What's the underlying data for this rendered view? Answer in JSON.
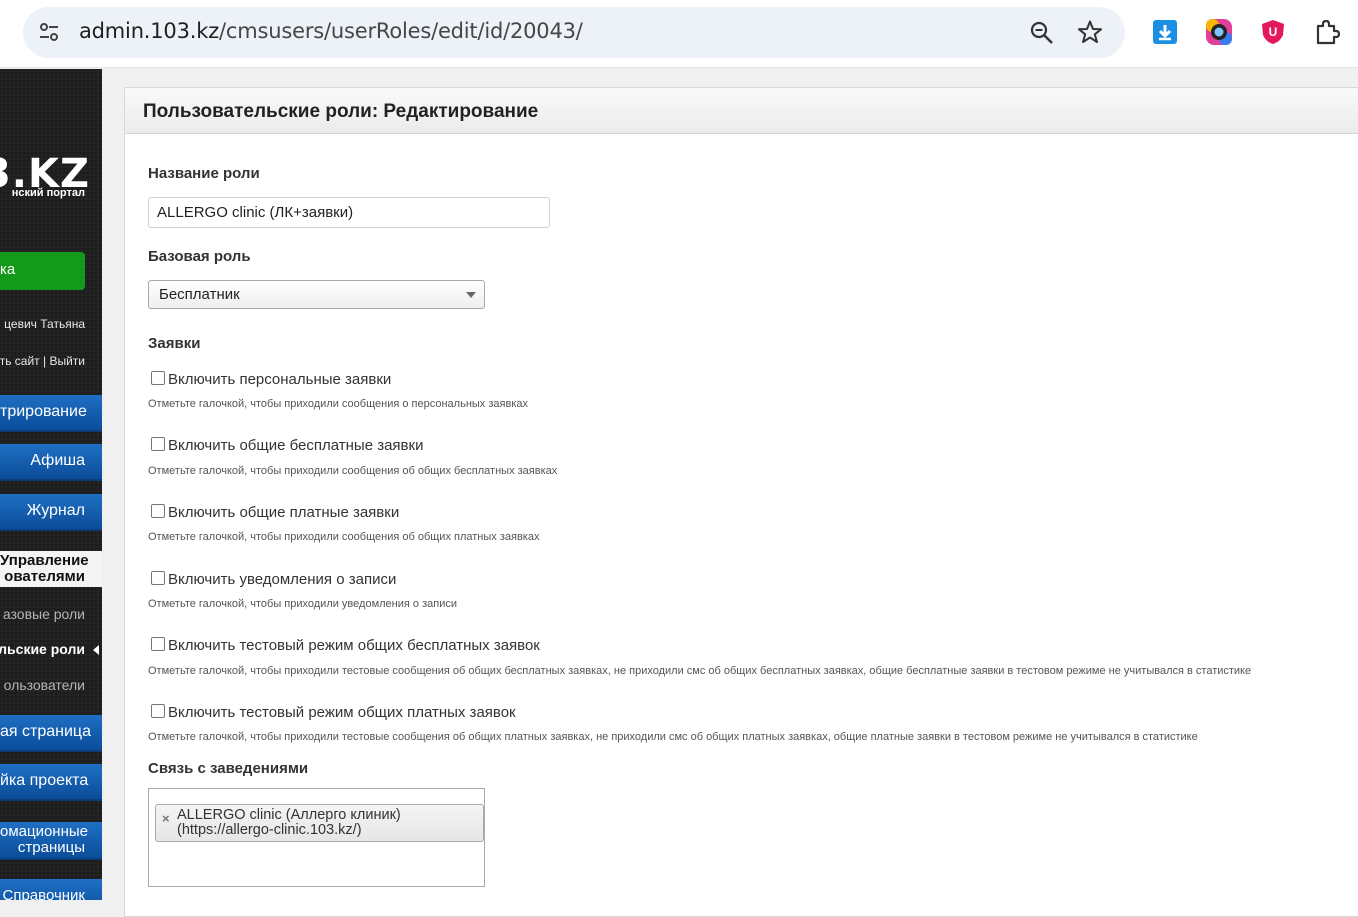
{
  "browser": {
    "url_host": "admin.103.kz",
    "url_path": "/cmsusers/userRoles/edit/id/20043/"
  },
  "sidebar": {
    "logo": "3.KZ",
    "logo_sub": "нский портал",
    "green_button": "ка",
    "user_name": "цевич Татьяна",
    "site_logout": "ть сайт | Выйти",
    "items": [
      {
        "label": "трирование"
      },
      {
        "label": "Афиша"
      },
      {
        "label": "Журнал"
      }
    ],
    "section_title_line1": "Управление",
    "section_title_line2": "ователями",
    "sub_items": [
      {
        "label": "азовые роли"
      },
      {
        "label": "льские роли"
      },
      {
        "label": "ользователи"
      }
    ],
    "items_bottom": [
      {
        "label": "ая страница"
      },
      {
        "label": "йка проекта"
      },
      {
        "label_line1": "омационные",
        "label_line2": "страницы"
      },
      {
        "label": "Справочник"
      }
    ]
  },
  "panel": {
    "title": "Пользовательские роли: Редактирование",
    "role_name_label": "Название роли",
    "role_name_value": "ALLERGO clinic (ЛК+заявки)",
    "base_role_label": "Базовая роль",
    "base_role_value": "Бесплатник",
    "requests_label": "Заявки",
    "checkboxes": [
      {
        "label": "Включить персональные заявки",
        "hint": "Отметьте галочкой, чтобы приходили сообщения о персональных заявках"
      },
      {
        "label": "Включить общие бесплатные заявки",
        "hint": "Отметьте галочкой, чтобы приходили сообщения об общих бесплатных заявках"
      },
      {
        "label": "Включить общие платные заявки",
        "hint": "Отметьте галочкой, чтобы приходили сообщения об общих платных заявках"
      },
      {
        "label": "Включить уведомления о записи",
        "hint": "Отметьте галочкой, чтобы приходили уведомления о записи"
      },
      {
        "label": "Включить тестовый режим общих бесплатных заявок",
        "hint": "Отметьте галочкой, чтобы приходили тестовые сообщения об общих бесплатных заявках, не приходили смс об общих бесплатных заявках, общие бесплатные заявки в тестовом режиме не учитывался в статистике"
      },
      {
        "label": "Включить тестовый режим общих платных заявок",
        "hint": "Отметьте галочкой, чтобы приходили тестовые сообщения об общих платных заявках, не приходили смс об общих платных заявках, общие платные заявки в тестовом режиме не учитывался в статистике"
      }
    ],
    "venues_label": "Связь с заведениями",
    "venue_chip_line1": "ALLERGO clinic (Аллерго клиник)",
    "venue_chip_line2": "(https://allergo-clinic.103.kz/)",
    "venue_chip_remove": "×"
  }
}
